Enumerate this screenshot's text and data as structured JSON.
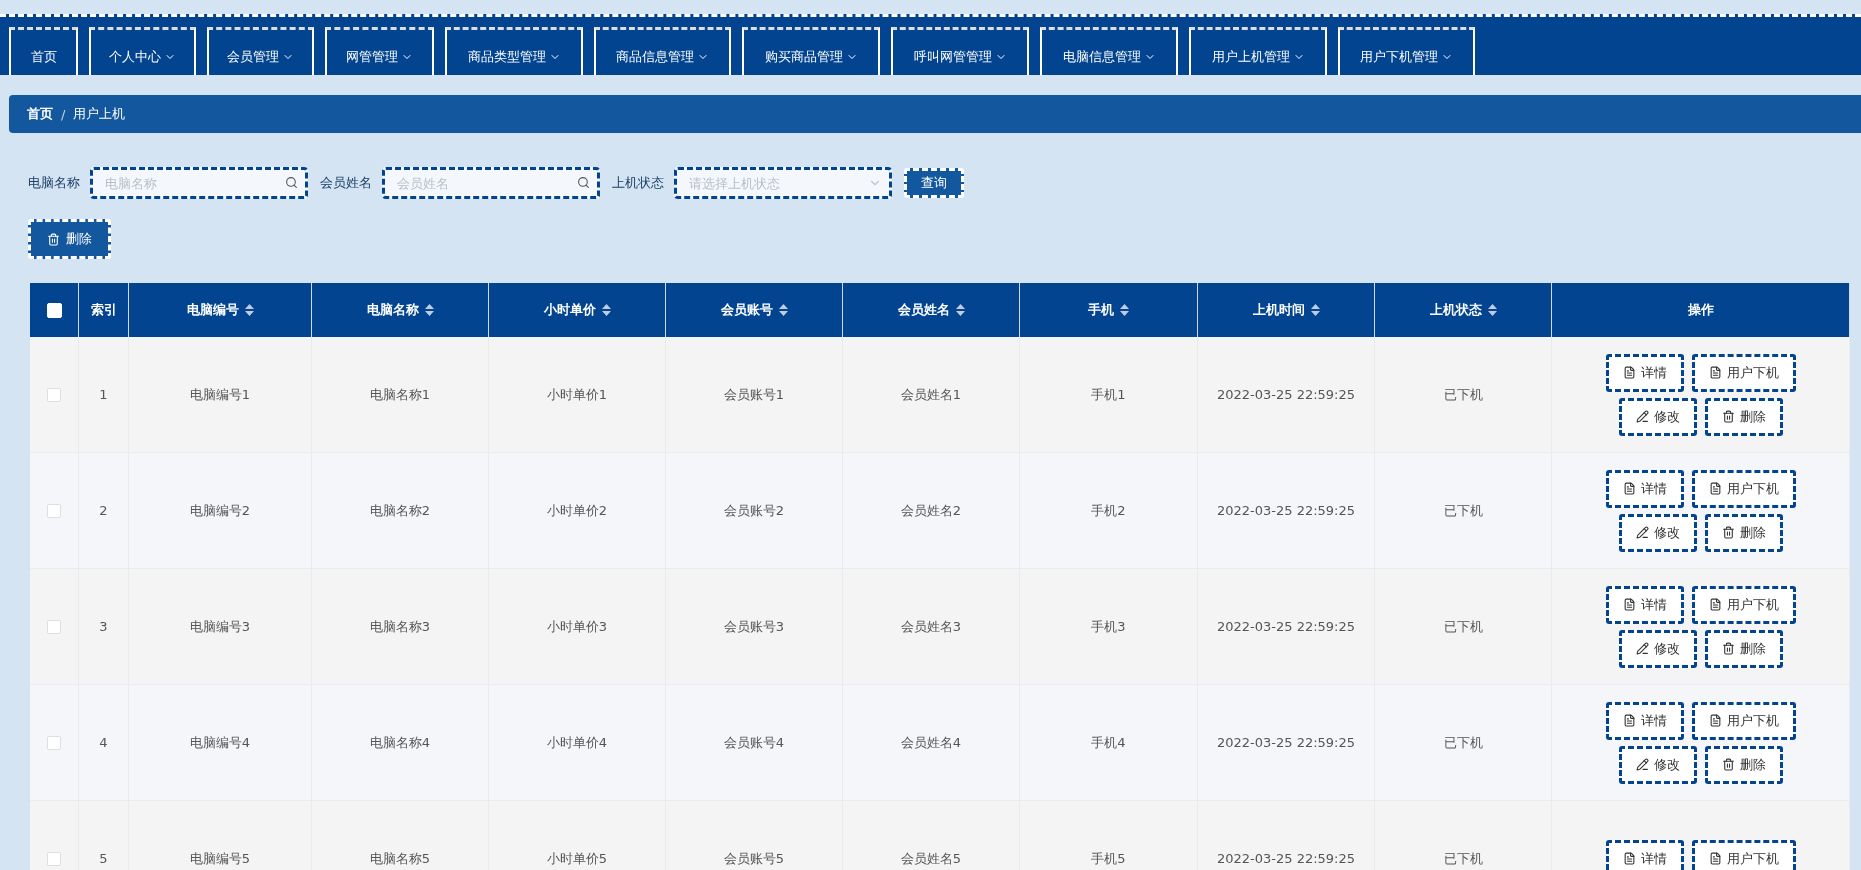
{
  "nav": [
    {
      "label": "首页",
      "dropdown": false
    },
    {
      "label": "个人中心",
      "dropdown": true
    },
    {
      "label": "会员管理",
      "dropdown": true
    },
    {
      "label": "网管管理",
      "dropdown": true
    },
    {
      "label": "商品类型管理",
      "dropdown": true
    },
    {
      "label": "商品信息管理",
      "dropdown": true
    },
    {
      "label": "购买商品管理",
      "dropdown": true
    },
    {
      "label": "呼叫网管管理",
      "dropdown": true
    },
    {
      "label": "电脑信息管理",
      "dropdown": true
    },
    {
      "label": "用户上机管理",
      "dropdown": true
    },
    {
      "label": "用户下机管理",
      "dropdown": true
    }
  ],
  "breadcrumb": {
    "items": [
      "首页",
      "用户上机"
    ],
    "separator": "/"
  },
  "filters": [
    {
      "kind": "input",
      "label": "电脑名称",
      "placeholder": "电脑名称"
    },
    {
      "kind": "input",
      "label": "会员姓名",
      "placeholder": "会员姓名"
    },
    {
      "kind": "select",
      "label": "上机状态",
      "placeholder": "请选择上机状态"
    }
  ],
  "search_button": "查询",
  "delete_button": "删除",
  "table": {
    "all_checked": false,
    "columns": [
      {
        "label": "索引",
        "sortable": false
      },
      {
        "label": "电脑编号",
        "sortable": true
      },
      {
        "label": "电脑名称",
        "sortable": true
      },
      {
        "label": "小时单价",
        "sortable": true
      },
      {
        "label": "会员账号",
        "sortable": true
      },
      {
        "label": "会员姓名",
        "sortable": true
      },
      {
        "label": "手机",
        "sortable": true
      },
      {
        "label": "上机时间",
        "sortable": true
      },
      {
        "label": "上机状态",
        "sortable": true
      },
      {
        "label": "操作",
        "sortable": false
      }
    ],
    "rows": [
      {
        "checked": false,
        "cells": [
          "1",
          "电脑编号1",
          "电脑名称1",
          "小时单价1",
          "会员账号1",
          "会员姓名1",
          "手机1",
          "2022-03-25 22:59:25",
          "已下机"
        ],
        "actions": [
          {
            "kind": "detail",
            "label": "详情"
          },
          {
            "kind": "detail",
            "label": "用户下机"
          },
          {
            "kind": "edit",
            "label": "修改"
          },
          {
            "kind": "delete",
            "label": "删除"
          }
        ]
      },
      {
        "checked": false,
        "cells": [
          "2",
          "电脑编号2",
          "电脑名称2",
          "小时单价2",
          "会员账号2",
          "会员姓名2",
          "手机2",
          "2022-03-25 22:59:25",
          "已下机"
        ],
        "actions": [
          {
            "kind": "detail",
            "label": "详情"
          },
          {
            "kind": "detail",
            "label": "用户下机"
          },
          {
            "kind": "edit",
            "label": "修改"
          },
          {
            "kind": "delete",
            "label": "删除"
          }
        ]
      },
      {
        "checked": false,
        "cells": [
          "3",
          "电脑编号3",
          "电脑名称3",
          "小时单价3",
          "会员账号3",
          "会员姓名3",
          "手机3",
          "2022-03-25 22:59:25",
          "已下机"
        ],
        "actions": [
          {
            "kind": "detail",
            "label": "详情"
          },
          {
            "kind": "detail",
            "label": "用户下机"
          },
          {
            "kind": "edit",
            "label": "修改"
          },
          {
            "kind": "delete",
            "label": "删除"
          }
        ]
      },
      {
        "checked": false,
        "cells": [
          "4",
          "电脑编号4",
          "电脑名称4",
          "小时单价4",
          "会员账号4",
          "会员姓名4",
          "手机4",
          "2022-03-25 22:59:25",
          "已下机"
        ],
        "actions": [
          {
            "kind": "detail",
            "label": "详情"
          },
          {
            "kind": "detail",
            "label": "用户下机"
          },
          {
            "kind": "edit",
            "label": "修改"
          },
          {
            "kind": "delete",
            "label": "删除"
          }
        ]
      },
      {
        "checked": false,
        "cells": [
          "5",
          "电脑编号5",
          "电脑名称5",
          "小时单价5",
          "会员账号5",
          "会员姓名5",
          "手机5",
          "2022-03-25 22:59:25",
          "已下机"
        ],
        "actions": [
          {
            "kind": "detail",
            "label": "详情"
          },
          {
            "kind": "detail",
            "label": "用户下机"
          }
        ]
      }
    ]
  }
}
